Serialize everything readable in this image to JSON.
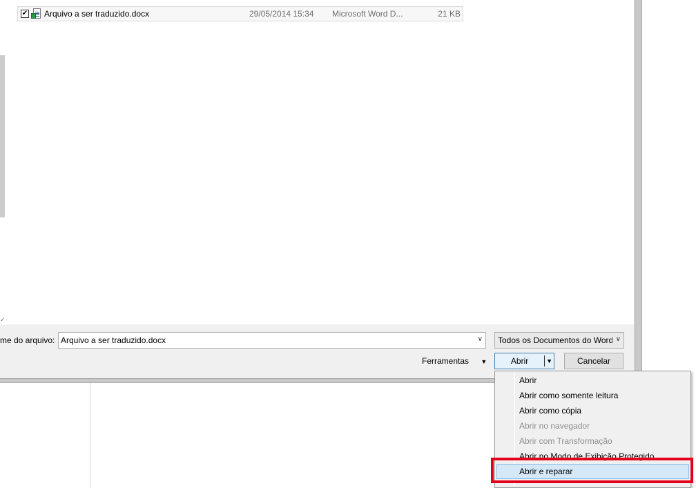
{
  "file_list": {
    "files": [
      {
        "checked": "✔",
        "name": "Arquivo a ser traduzido.docx",
        "date": "29/05/2014 15:34",
        "type": "Microsoft Word D...",
        "size": "21 KB"
      }
    ]
  },
  "bottom": {
    "filename_label": "me do arquivo:",
    "filename_value": "Arquivo a ser traduzido.docx",
    "filetype_value": "Todos os Documentos do Word",
    "tools_label": "Ferramentas",
    "open_label": "Abrir",
    "cancel_label": "Cancelar"
  },
  "open_menu": {
    "items": [
      {
        "label": "Abrir",
        "state": "enabled"
      },
      {
        "label": "Abrir como somente leitura",
        "state": "enabled"
      },
      {
        "label": "Abrir como cópia",
        "state": "enabled"
      },
      {
        "label": "Abrir no navegador",
        "state": "disabled"
      },
      {
        "label": "Abrir com Transformação",
        "state": "disabled"
      },
      {
        "label": "Abrir no Modo de Exibição Protegido",
        "state": "enabled"
      },
      {
        "label": "Abrir e reparar",
        "state": "highlighted"
      }
    ]
  },
  "colors": {
    "highlight_box": "#e3001b",
    "menu_hover": "#d5e8f8",
    "primary_button_border": "#3c7fb1"
  },
  "icons": {
    "file_icon": "word-document-icon",
    "dropdown_arrow": "chevron-down-icon",
    "split_arrow": "triangle-down-icon"
  }
}
